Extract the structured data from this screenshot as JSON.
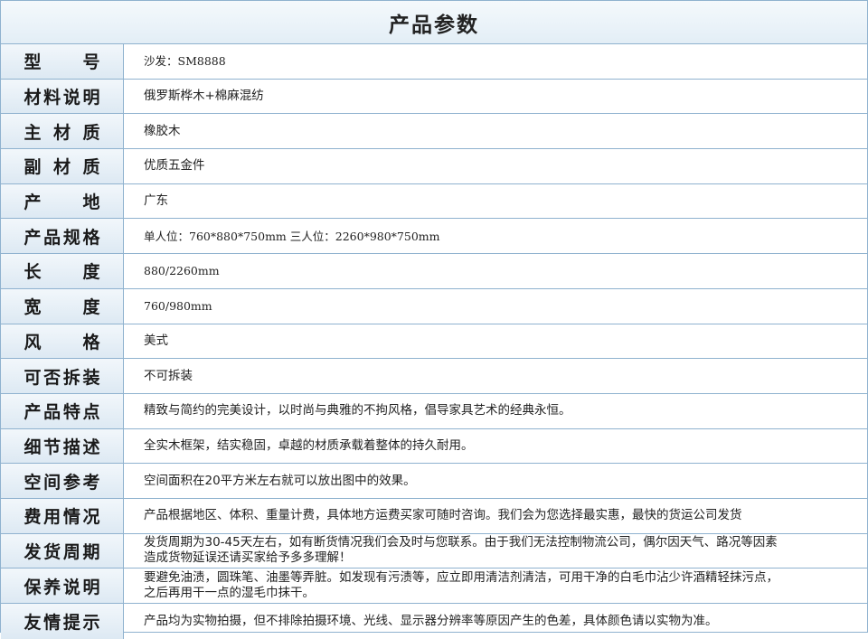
{
  "title": "产品参数",
  "rows": [
    {
      "label": "型号",
      "value": "沙发：SM8888"
    },
    {
      "label": "材料说明",
      "value": "俄罗斯桦木+棉麻混纺"
    },
    {
      "label": "主材质",
      "value": "橡胶木"
    },
    {
      "label": "副材质",
      "value": "优质五金件"
    },
    {
      "label": "产地",
      "value": "广东"
    },
    {
      "label": "产品规格",
      "value": "单人位：760*880*750mm  三人位：2260*980*750mm"
    },
    {
      "label": "长度",
      "value": "880/2260mm"
    },
    {
      "label": "宽度",
      "value": "760/980mm"
    },
    {
      "label": "风格",
      "value": "美式"
    },
    {
      "label": "可否拆装",
      "value": "不可拆装"
    },
    {
      "label": "产品特点",
      "value": "精致与简约的完美设计，以时尚与典雅的不拘风格，倡导家具艺术的经典永恒。"
    },
    {
      "label": "细节描述",
      "value": "全实木框架，结实稳固，卓越的材质承载着整体的持久耐用。"
    },
    {
      "label": "空间参考",
      "value": "空间面积在20平方米左右就可以放出图中的效果。"
    },
    {
      "label": "费用情况",
      "value": "产品根据地区、体积、重量计费，具体地方运费买家可随时咨询。我们会为您选择最实惠，最快的货运公司发货"
    },
    {
      "label": "发货周期",
      "value": "发货周期为30-45天左右，如有断货情况我们会及时与您联系。由于我们无法控制物流公司，偶尔因天气、路况等因素\n造成货物延误还请买家给予多多理解！"
    },
    {
      "label": "保养说明",
      "value": "要避免油渍，圆珠笔、油墨等弄脏。如发现有污渍等，应立即用清洁剂清洁，可用干净的白毛巾沾少许酒精轻抹污点，\n之后再用干一点的湿毛巾抹干。"
    },
    {
      "label": "友情提示",
      "value": "产品均为实物拍摄，但不排除拍摄环境、光线、显示器分辨率等原因产生的色差，具体颜色请以实物为准。"
    }
  ]
}
